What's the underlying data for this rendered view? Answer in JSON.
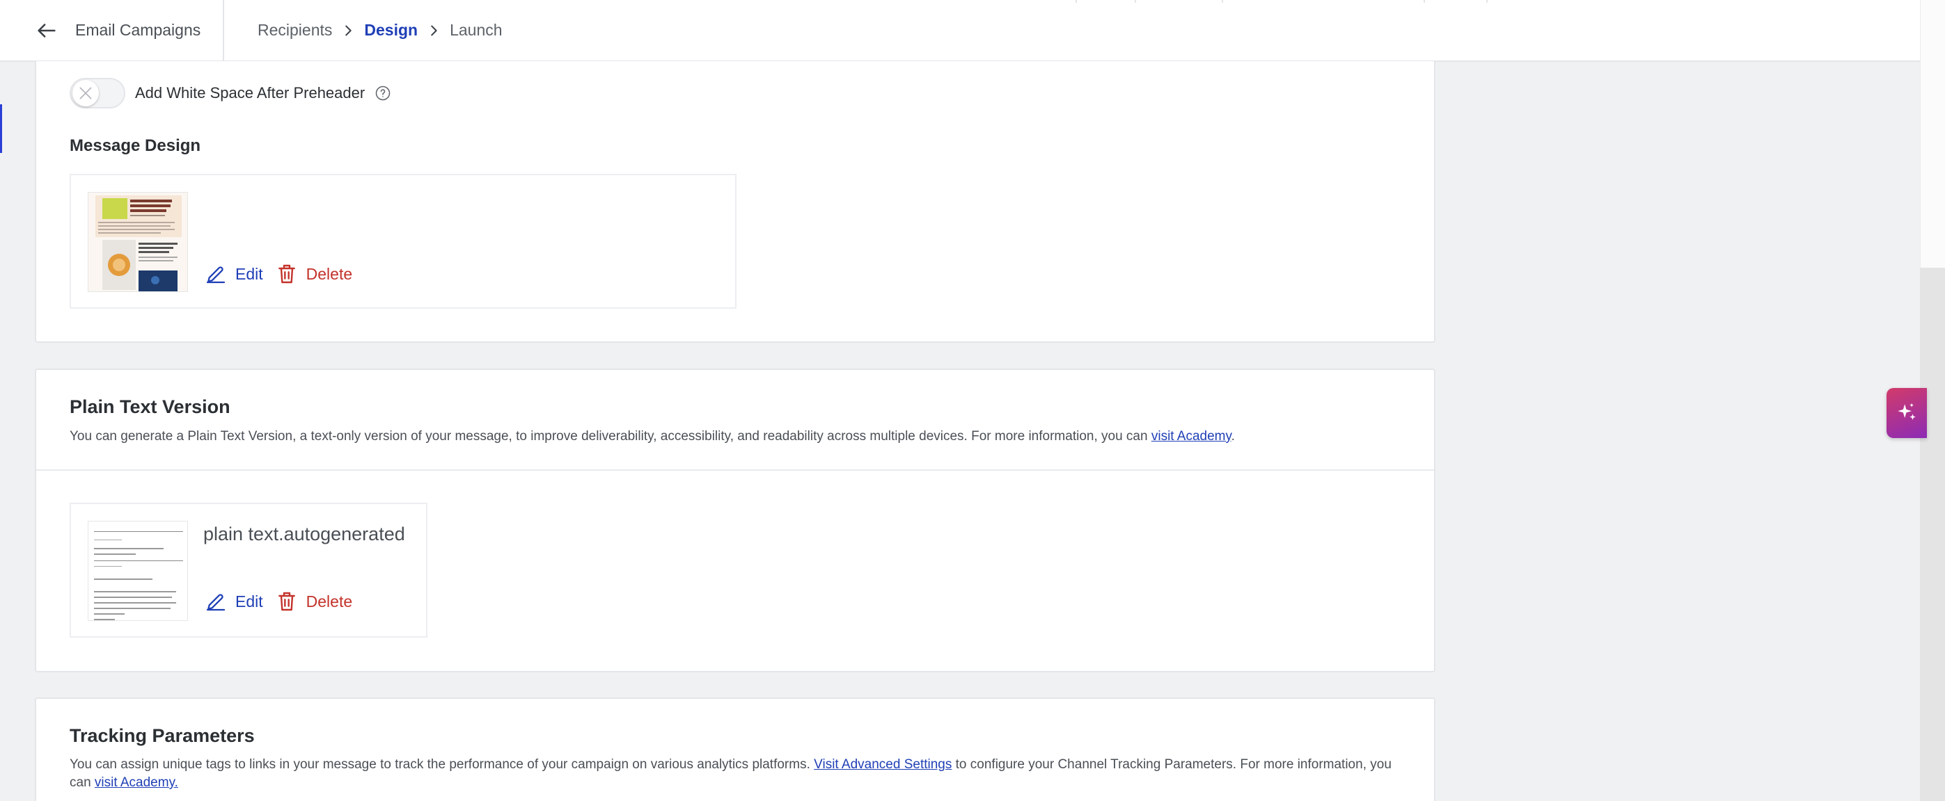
{
  "header": {
    "back_label": "Email Campaigns",
    "breadcrumbs": [
      {
        "label": "Recipients",
        "active": false
      },
      {
        "label": "Design",
        "active": true
      },
      {
        "label": "Launch",
        "active": false
      }
    ]
  },
  "design_section": {
    "toggle_label": "Add White Space After Preheader",
    "toggle_on": false,
    "heading": "Message Design",
    "edit_label": "Edit",
    "delete_label": "Delete"
  },
  "plain_text": {
    "title": "Plain Text Version",
    "desc_before": "You can generate a Plain Text Version, a text-only version of your message, to improve deliverability, accessibility, and readability across multiple devices. For more information, you can ",
    "desc_link": "visit Academy",
    "desc_after": ".",
    "file_name": "plain text.autogenerated",
    "edit_label": "Edit",
    "delete_label": "Delete"
  },
  "tracking": {
    "title": "Tracking Parameters",
    "desc_part1": "You can assign unique tags to links in your message to track the performance of your campaign on various analytics platforms. ",
    "link1": "Visit Advanced Settings",
    "desc_part2": " to configure your Channel Tracking Parameters. For more information, you can ",
    "link2": "visit Academy."
  },
  "colors": {
    "accent": "#1f3fb6",
    "danger": "#c4332b",
    "ai_gradient_start": "#d23b6a",
    "ai_gradient_end": "#8c2bb5"
  },
  "icons": {
    "back": "arrow-left-icon",
    "separator": "chevron-right-icon",
    "toggle_off": "x-icon",
    "help": "question-circle-icon",
    "edit": "pencil-icon",
    "delete": "trash-icon",
    "ai": "sparkle-icon"
  }
}
